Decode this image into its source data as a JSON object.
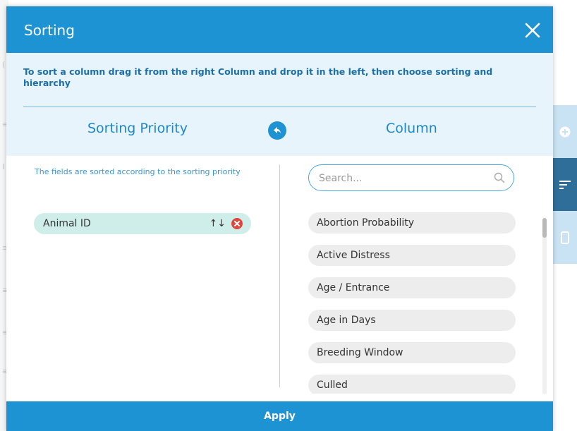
{
  "dialog": {
    "title": "Sorting",
    "instructions": "To sort a column drag it from the right Column and drop it in the left, then choose sorting and hierarchy",
    "apply_label": "Apply"
  },
  "left_pane": {
    "title": "Sorting Priority",
    "hint": "The fields are sorted according to the sorting priority",
    "sorted_fields": [
      {
        "label": "Animal ID",
        "sort_glyph": "↑↓"
      }
    ]
  },
  "right_pane": {
    "title": "Column",
    "search": {
      "placeholder": "Search...",
      "value": ""
    },
    "columns": [
      "Abortion Probability",
      "Active Distress",
      "Age / Entrance",
      "Age in Days",
      "Breeding Window",
      "Culled"
    ]
  },
  "colors": {
    "header": "#1d93d3",
    "band": "#e8f4fb",
    "chip": "#cfeeea",
    "remove": "#e2453c",
    "toolbar_active": "#2f6e98",
    "toolbar_light": "#c9e3f4"
  },
  "icons": {
    "close": "close-icon",
    "back": "arrow-left-icon",
    "search": "search-icon",
    "remove": "remove-icon",
    "toolbar": [
      "add-icon",
      "sort-icon",
      "mobile-icon"
    ]
  }
}
